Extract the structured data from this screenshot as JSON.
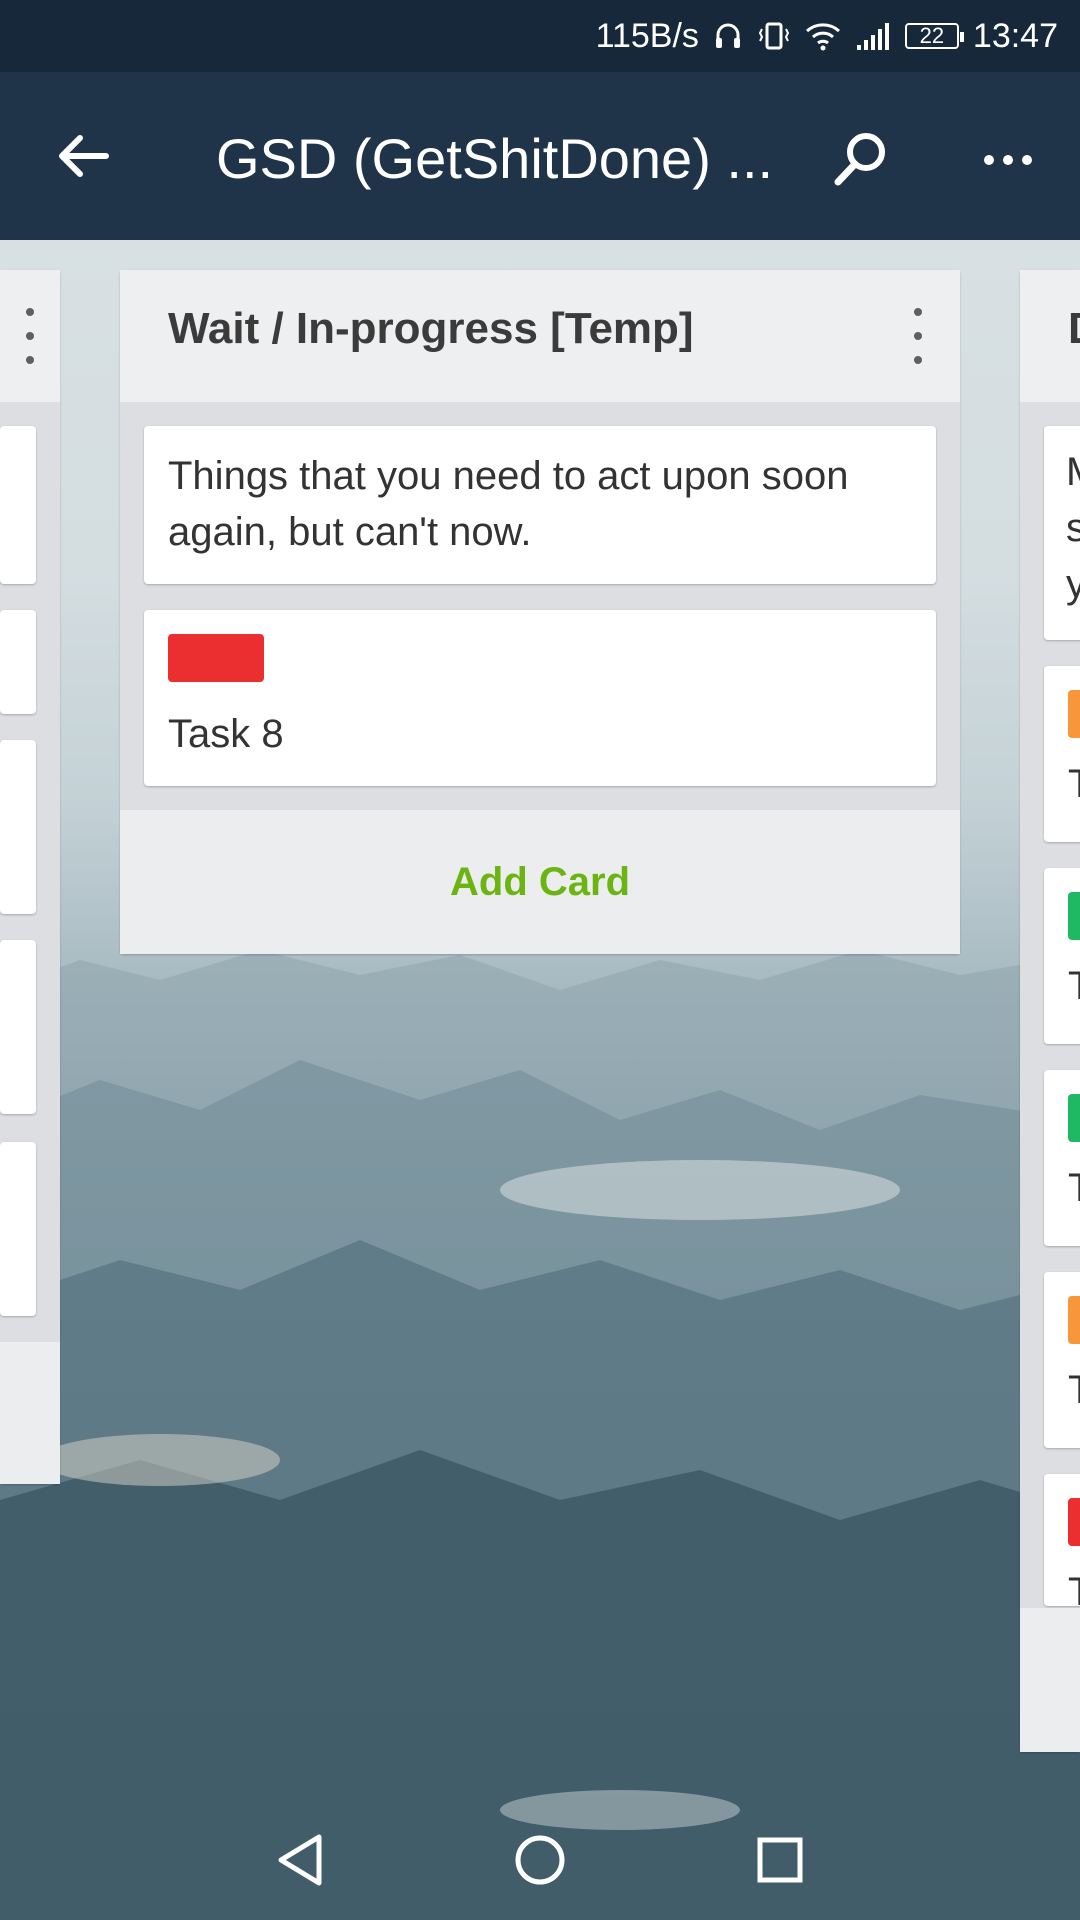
{
  "status_bar": {
    "network_speed": "115B/s",
    "battery_level": "22",
    "time": "13:47",
    "icons": [
      "headphones-icon",
      "vibrate-icon",
      "wifi-icon",
      "signal-icon",
      "battery-icon"
    ]
  },
  "toolbar": {
    "title": "GSD (GetShitDone) ...",
    "icons": {
      "back": "back-arrow-icon",
      "search": "search-icon",
      "more": "more-horizontal-icon"
    }
  },
  "current_list": {
    "title": "Wait / In-progress [Temp]",
    "cards": [
      {
        "text": "Things that you need to act upon soon again, but can't now."
      },
      {
        "label_color": "#eb2f30",
        "text": "Task 8"
      }
    ],
    "add_card_label": "Add Card"
  },
  "right_list": {
    "title_visible": "D",
    "first_card_visible": [
      "M",
      "s",
      "y"
    ],
    "cards": [
      {
        "label_color": "#f7963a",
        "text_visible": "T"
      },
      {
        "label_color": "#1fb964",
        "text_visible": "T"
      },
      {
        "label_color": "#1fb964",
        "text_visible": "T"
      },
      {
        "label_color": "#f7963a",
        "text_visible": "T"
      },
      {
        "label_color": "#eb2f30",
        "text_visible": "T"
      }
    ]
  },
  "colors": {
    "status_bar": "#16283a",
    "toolbar": "#1f3448",
    "add_card_text": "#6bb411"
  },
  "nav": {
    "icons": [
      "back-triangle-icon",
      "home-circle-icon",
      "recents-square-icon"
    ]
  }
}
